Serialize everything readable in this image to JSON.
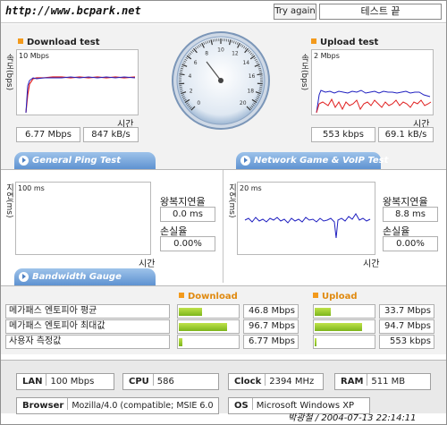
{
  "header": {
    "url": "http://www.bcpark.net",
    "try_again": "Try again",
    "status": "테스트 끝"
  },
  "download": {
    "title": "Download test",
    "scale": "10 Mbps",
    "ylabel": "속도(bps)",
    "xlabel": "시간",
    "rate1": "6.77 Mbps",
    "rate2": "847 kB/s"
  },
  "upload": {
    "title": "Upload test",
    "scale": "2 Mbps",
    "ylabel": "속도(bps)",
    "xlabel": "시간",
    "rate1": "553 kbps",
    "rate2": "69.1 kB/s"
  },
  "gauge": {
    "ticks": [
      "0",
      "1",
      "2",
      "3",
      "4",
      "5",
      "6",
      "7",
      "8",
      "9",
      "10",
      "11",
      "12",
      "13",
      "14",
      "15",
      "16",
      "17",
      "18",
      "19",
      "20"
    ]
  },
  "tabs": {
    "ping": "General Ping Test",
    "game": "Network Game & VoIP Test",
    "bandwidth": "Bandwidth Gauge"
  },
  "ping_left": {
    "scale": "100 ms",
    "ylabel": "지연(ms)",
    "xlabel": "시간",
    "rtt_label": "왕복지연율",
    "rtt_value": "0.0 ms",
    "loss_label": "손실율",
    "loss_value": "0.00%"
  },
  "ping_right": {
    "scale": "20 ms",
    "ylabel": "지연(ms)",
    "xlabel": "시간",
    "rtt_label": "왕복지연율",
    "rtt_value": "8.8 ms",
    "loss_label": "손실율",
    "loss_value": "0.00%"
  },
  "bandwidth": {
    "download_header": "Download",
    "upload_header": "Upload",
    "rows": [
      {
        "name": "메가패스 엔토피아 평균",
        "down_value": "46.8 Mbps",
        "down_fill": 0.4,
        "up_value": "33.7 Mbps",
        "up_fill": 0.27
      },
      {
        "name": "메가패스 엔토피아 최대값",
        "down_value": "96.7 Mbps",
        "down_fill": 0.82,
        "up_value": "94.7 Mbps",
        "up_fill": 0.8
      },
      {
        "name": "사용자 측정값",
        "down_value": "6.77 Mbps",
        "down_fill": 0.06,
        "up_value": "553 kbps",
        "up_fill": 0.02
      }
    ]
  },
  "system": {
    "lan_label": "LAN",
    "lan_value": "100 Mbps",
    "cpu_label": "CPU",
    "cpu_value": "586",
    "clock_label": "Clock",
    "clock_value": "2394 MHz",
    "ram_label": "RAM",
    "ram_value": "511 MB",
    "browser_label": "Browser",
    "browser_value": "Mozilla/4.0 (compatible; MSIE 6.0",
    "os_label": "OS",
    "os_value": "Microsoft Windows XP"
  },
  "footer": "박광철 / 2004-07-13 22:14:11",
  "colors": {
    "accent": "#f39a1c",
    "tab_blue": "#5e92d1",
    "bar_green": "#8cc21f",
    "line_red": "#e02020",
    "line_blue": "#2020c0"
  }
}
